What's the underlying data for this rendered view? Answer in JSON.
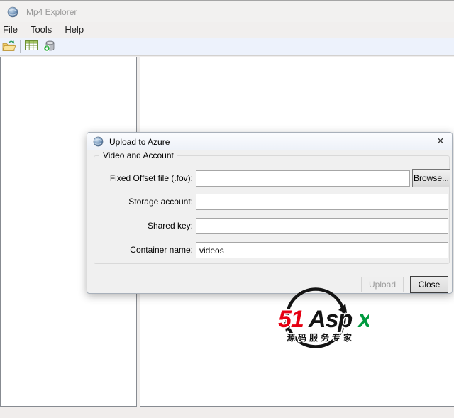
{
  "window": {
    "title": "Mp4 Explorer"
  },
  "menu": {
    "items": [
      {
        "label": "File"
      },
      {
        "label": "Tools"
      },
      {
        "label": "Help"
      }
    ]
  },
  "toolbar": {
    "buttons": [
      {
        "icon": "open-folder-icon"
      },
      {
        "icon": "metadata-grid-icon"
      },
      {
        "icon": "upload-database-icon"
      }
    ]
  },
  "dialog": {
    "title": "Upload to Azure",
    "close_glyph": "✕",
    "group_title": "Video and Account",
    "fields": [
      {
        "label": "Fixed Offset file (.fov):",
        "value": ""
      },
      {
        "label": "Storage account:",
        "value": ""
      },
      {
        "label": "Shared key:",
        "value": ""
      },
      {
        "label": "Container name:",
        "value": "videos"
      }
    ],
    "buttons": {
      "browse": "Browse...",
      "upload": "Upload",
      "close": "Close"
    }
  },
  "watermark": {
    "part_51": "51",
    "part_asp": "Asp",
    "part_x": "x",
    "subtitle": "源码服务专家",
    "colors": {
      "red": "#e60012",
      "green": "#009a3e",
      "black": "#141414"
    }
  }
}
